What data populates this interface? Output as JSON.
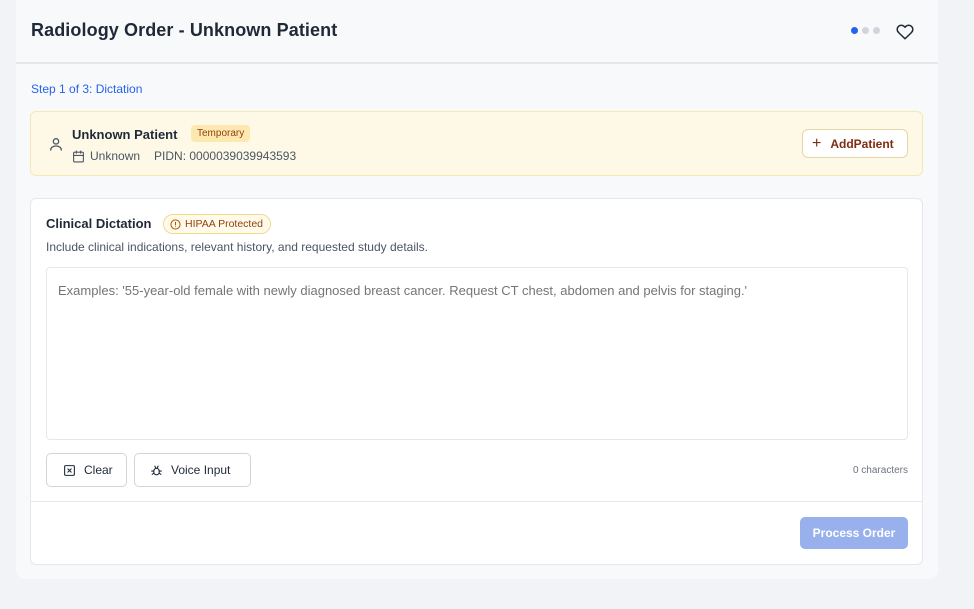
{
  "header": {
    "title": "Radiology Order - Unknown Patient"
  },
  "stepper": {
    "step_label": "Step 1 of 3: Dictation"
  },
  "patient": {
    "name": "Unknown Patient",
    "badge": "Temporary",
    "dob": "Unknown",
    "pidn": "PIDN: 0000039039943593",
    "add_button_label": "AddPatient"
  },
  "dictation": {
    "title": "Clinical Dictation",
    "hipaa_badge": "HIPAA Protected",
    "subtitle": "Include clinical indications, relevant history, and requested study details.",
    "textarea_value": "",
    "textarea_placeholder": "Examples: '55-year-old female with newly diagnosed breast cancer. Request CT chest, abdomen and pelvis for staging.'",
    "clear_label": "Clear",
    "voice_label": "Voice Input",
    "char_count": "0 characters",
    "process_label": "Process Order"
  },
  "colors": {
    "accent": "#2563eb",
    "patient_bg": "#fef9e6",
    "process_disabled": "#98b1ec"
  },
  "icons": [
    "heart-icon",
    "user-icon",
    "calendar-icon",
    "plus-icon",
    "alert-circle-icon",
    "x-square-icon",
    "bug-icon"
  ]
}
